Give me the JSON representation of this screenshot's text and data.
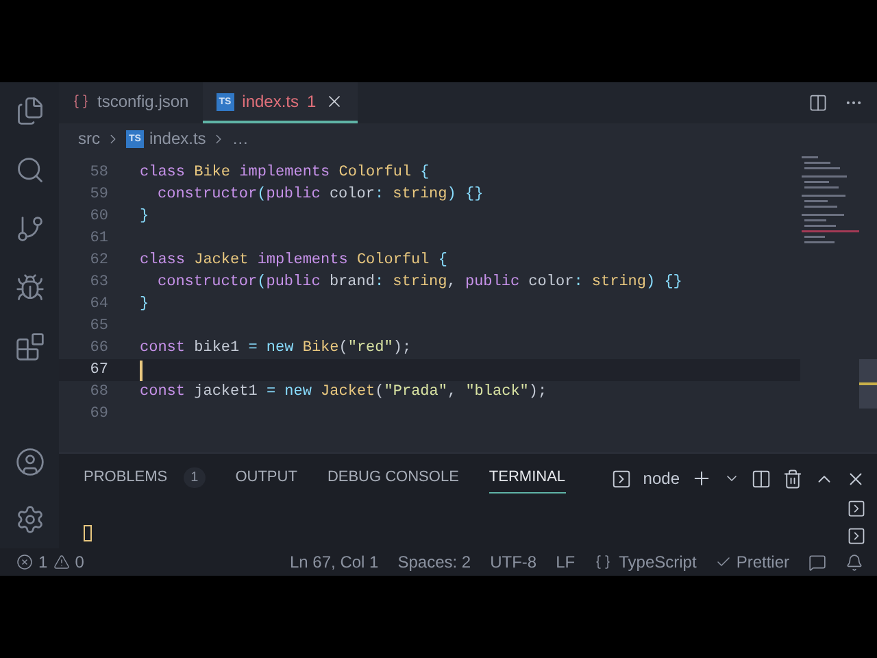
{
  "tabs": [
    {
      "label": "tsconfig.json",
      "kind": "json",
      "selected": false
    },
    {
      "label": "index.ts",
      "kind": "ts",
      "badge": "TS",
      "problems": "1",
      "selected": true
    }
  ],
  "breadcrumbs": {
    "folder": "src",
    "file": "index.ts",
    "badge": "TS",
    "more": "…"
  },
  "code": {
    "lines": [
      {
        "number": "58",
        "current": false,
        "indent": false,
        "tokens": [
          {
            "t": "class ",
            "kind": "kw"
          },
          {
            "t": "Bike ",
            "kind": "type"
          },
          {
            "t": "implements ",
            "kind": "kw"
          },
          {
            "t": "Colorful",
            "kind": "type"
          },
          {
            "t": " {",
            "kind": "op"
          }
        ]
      },
      {
        "number": "59",
        "current": false,
        "indent": true,
        "tokens": [
          {
            "t": "constructor",
            "kind": "kw"
          },
          {
            "t": "(",
            "kind": "op"
          },
          {
            "t": "public",
            "kind": "kw"
          },
          {
            "t": " color",
            "kind": "plain"
          },
          {
            "t": ": ",
            "kind": "op"
          },
          {
            "t": "string",
            "kind": "type"
          },
          {
            "t": ") {}",
            "kind": "op"
          }
        ]
      },
      {
        "number": "60",
        "current": false,
        "indent": false,
        "tokens": [
          {
            "t": "}",
            "kind": "op"
          }
        ]
      },
      {
        "number": "61",
        "current": false
      },
      {
        "number": "62",
        "current": false,
        "indent": false,
        "tokens": [
          {
            "t": "class ",
            "kind": "kw"
          },
          {
            "t": "Jacket ",
            "kind": "type"
          },
          {
            "t": "implements ",
            "kind": "kw"
          },
          {
            "t": "Colorful",
            "kind": "type"
          },
          {
            "t": " {",
            "kind": "op"
          }
        ]
      },
      {
        "number": "63",
        "current": false,
        "indent": true,
        "tokens": [
          {
            "t": "constructor",
            "kind": "kw"
          },
          {
            "t": "(",
            "kind": "op"
          },
          {
            "t": "public",
            "kind": "kw"
          },
          {
            "t": " brand",
            "kind": "plain"
          },
          {
            "t": ": ",
            "kind": "op"
          },
          {
            "t": "string",
            "kind": "type"
          },
          {
            "t": ", ",
            "kind": "plain"
          },
          {
            "t": "public",
            "kind": "kw"
          },
          {
            "t": " color",
            "kind": "plain"
          },
          {
            "t": ": ",
            "kind": "op"
          },
          {
            "t": "string",
            "kind": "type"
          },
          {
            "t": ") {}",
            "kind": "op"
          }
        ]
      },
      {
        "number": "64",
        "current": false,
        "indent": false,
        "tokens": [
          {
            "t": "}",
            "kind": "op"
          }
        ]
      },
      {
        "number": "65",
        "current": false
      },
      {
        "number": "66",
        "current": false,
        "indent": false,
        "tokens": [
          {
            "t": "const",
            "kind": "kw"
          },
          {
            "t": " bike1 ",
            "kind": "plain"
          },
          {
            "t": "= new ",
            "kind": "op"
          },
          {
            "t": "Bike",
            "kind": "type"
          },
          {
            "t": "(",
            "kind": "plain"
          },
          {
            "t": "\"red\"",
            "kind": "str"
          },
          {
            "t": ");",
            "kind": "plain"
          }
        ]
      },
      {
        "number": "67",
        "current": true
      },
      {
        "number": "68",
        "current": false,
        "indent": false,
        "tokens": [
          {
            "t": "const",
            "kind": "kw"
          },
          {
            "t": " jacket1 ",
            "kind": "plain"
          },
          {
            "t": "= new ",
            "kind": "op"
          },
          {
            "t": "Jacket",
            "kind": "type"
          },
          {
            "t": "(",
            "kind": "plain"
          },
          {
            "t": "\"Prada\"",
            "kind": "str"
          },
          {
            "t": ", ",
            "kind": "plain"
          },
          {
            "t": "\"black\"",
            "kind": "str"
          },
          {
            "t": ");",
            "kind": "plain"
          }
        ]
      },
      {
        "number": "69",
        "current": false
      }
    ]
  },
  "panel": {
    "tabs": [
      {
        "label": "PROBLEMS",
        "count": "1",
        "selected": false
      },
      {
        "label": "OUTPUT",
        "selected": false
      },
      {
        "label": "DEBUG CONSOLE",
        "selected": false
      },
      {
        "label": "TERMINAL",
        "selected": true
      }
    ],
    "terminal_name": "node"
  },
  "status_bar": {
    "errors": "1",
    "warnings": "0",
    "position": "Ln 67, Col 1",
    "spaces": "Spaces: 2",
    "encoding": "UTF-8",
    "eol": "LF",
    "language": "TypeScript",
    "formatter": "Prettier"
  }
}
